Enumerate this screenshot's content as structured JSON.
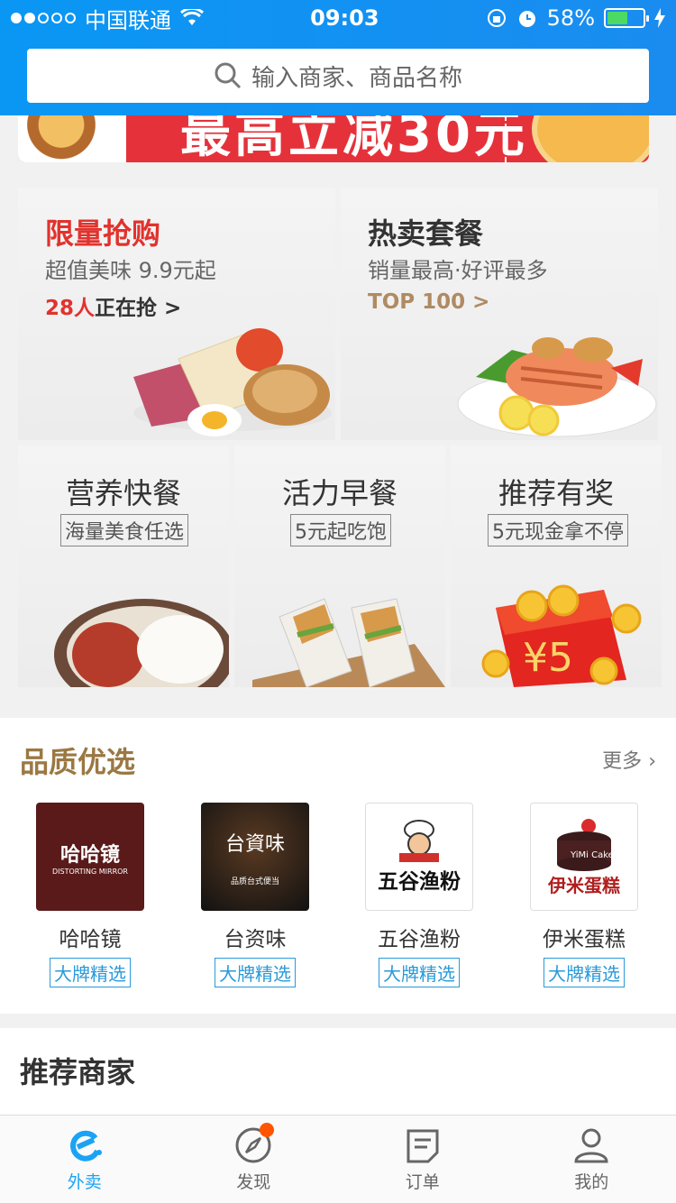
{
  "status": {
    "carrier": "中国联通",
    "time": "09:03",
    "battery": "58%",
    "battery_level": 0.58
  },
  "search": {
    "placeholder": "输入商家、商品名称"
  },
  "banner": {
    "text": "最高立减30元"
  },
  "promos": [
    {
      "title": "限量抢购",
      "subtitle": "超值美味 9.9元起",
      "count": "28人",
      "link_suffix": "正在抢 >",
      "title_color": "#e2322d"
    },
    {
      "title": "热卖套餐",
      "subtitle": "销量最高·好评最多",
      "link": "TOP 100 >",
      "link_color": "#b08a62"
    },
    {
      "title": "营养快餐",
      "tag": "海量美食任选"
    },
    {
      "title": "活力早餐",
      "tag": "5元起吃饱"
    },
    {
      "title": "推荐有奖",
      "tag": "5元现金拿不停"
    }
  ],
  "quality": {
    "title": "品质优选",
    "more": "更多",
    "brands": [
      {
        "name": "哈哈镜",
        "tag": "大牌精选",
        "logo_text": "哈哈镜",
        "logo_sub": "DISTORTING MIRROR"
      },
      {
        "name": "台资味",
        "tag": "大牌精选",
        "logo_text": "台資味",
        "logo_sub": "品质台式便当"
      },
      {
        "name": "五谷渔粉",
        "tag": "大牌精选",
        "logo_text": "五谷渔粉"
      },
      {
        "name": "伊米蛋糕",
        "tag": "大牌精选",
        "logo_text": "伊米蛋糕",
        "logo_sub": "YiMi Cake"
      }
    ]
  },
  "recommend": {
    "title": "推荐商家"
  },
  "tabs": [
    {
      "label": "外卖",
      "icon": "eleme-icon",
      "active": true
    },
    {
      "label": "发现",
      "icon": "compass-icon",
      "badge": true
    },
    {
      "label": "订单",
      "icon": "order-icon"
    },
    {
      "label": "我的",
      "icon": "profile-icon"
    }
  ]
}
